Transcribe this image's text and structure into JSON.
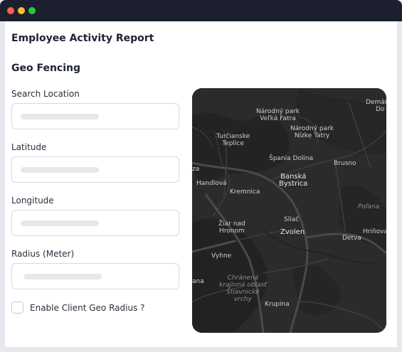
{
  "window": {
    "title": ""
  },
  "page": {
    "report_title": "Employee Activity Report",
    "section_title": "Geo Fencing"
  },
  "form": {
    "search_location": {
      "label": "Search Location",
      "value": ""
    },
    "latitude": {
      "label": "Latitude",
      "value": ""
    },
    "longitude": {
      "label": "Longitude",
      "value": ""
    },
    "radius": {
      "label": "Radius (Meter)",
      "value": ""
    },
    "enable_client_geo_radius": {
      "label": "Enable Client Geo Radius ?",
      "checked": false
    }
  },
  "map": {
    "labels": {
      "np_velka_fatra": [
        "Národný park",
        "Veľká Fatra"
      ],
      "np_nizke_tatry": [
        "Národný park",
        "Nízke Tatry"
      ],
      "demand": [
        "Demän",
        "Do"
      ],
      "turcianske": [
        "Turčianske",
        "Teplice"
      ],
      "spania_dolina": "Špania Dolina",
      "brusno": "Brusno",
      "banska_bystrica": [
        "Banská",
        "Bystrica"
      ],
      "handlova": "Handlová",
      "kremnica": "Kremnica",
      "za": "za",
      "polana": "Poľana",
      "sliac": "Sliač",
      "ziar": [
        "Žiar nad",
        "Hronom"
      ],
      "zvolen": "Zvolen",
      "detva": "Detva",
      "hrinova": "Hriňova",
      "vyhne": "Vyhne",
      "ana": "ana",
      "chranena": [
        "Chránená",
        "krajinná oblasť",
        "Štiavnické",
        "vrchy"
      ],
      "krupina": "Krupina"
    }
  },
  "colors": {
    "titlebar": "#1b1f2e",
    "map_background": "#2a2a2a",
    "text": "#1d2233"
  }
}
